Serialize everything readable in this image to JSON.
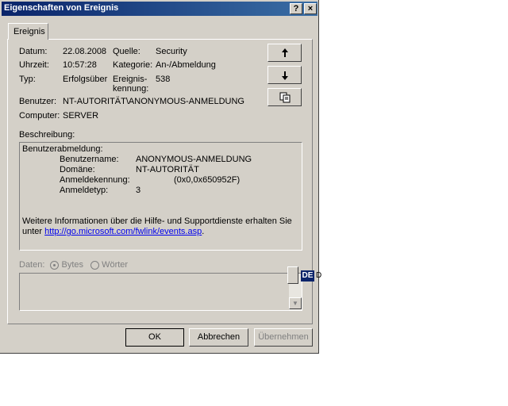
{
  "window": {
    "title": "Eigenschaften von Ereignis",
    "help_btn": "?",
    "close_btn": "×"
  },
  "tab": {
    "label": "Ereignis"
  },
  "fields": {
    "datum_label": "Datum:",
    "datum_value": "22.08.2008",
    "uhrzeit_label": "Uhrzeit:",
    "uhrzeit_value": "10:57:28",
    "typ_label": "Typ:",
    "typ_value": "Erfolgsüber",
    "quelle_label": "Quelle:",
    "quelle_value": "Security",
    "kategorie_label": "Kategorie:",
    "kategorie_value": "An-/Abmeldung",
    "ereignis_label_1": "Ereignis-",
    "ereignis_label_2": "kennung:",
    "ereignis_value": "538",
    "benutzer_label": "Benutzer:",
    "benutzer_value": "NT-AUTORITÄT\\ANONYMOUS-ANMELDUNG",
    "computer_label": "Computer:",
    "computer_value": "SERVER"
  },
  "nav": {
    "up": "↑",
    "down": "↓",
    "copy": "copy"
  },
  "beschreibung": {
    "label": "Beschreibung:",
    "heading": "Benutzerabmeldung:",
    "rows": [
      {
        "key": "Benutzername:",
        "value": "ANONYMOUS-ANMELDUNG"
      },
      {
        "key": "Domäne:",
        "value": "NT-AUTORITÄT"
      },
      {
        "key": "Anmeldekennung:",
        "value": "(0x0,0x650952F)"
      },
      {
        "key": "Anmeldetyp:",
        "value": "3"
      }
    ],
    "info_text": "Weitere Informationen über die Hilfe- und Supportdienste erhalten Sie",
    "info_prefix": "unter",
    "link": "http://go.microsoft.com/fwlink/events.asp",
    "link_suffix": "."
  },
  "daten": {
    "label": "Daten:",
    "bytes": "Bytes",
    "woerter": "Wörter"
  },
  "buttons": {
    "ok": "OK",
    "cancel": "Abbrechen",
    "apply": "Übernehmen"
  },
  "language_indicator": {
    "code": "DE",
    "trailing": "D"
  }
}
